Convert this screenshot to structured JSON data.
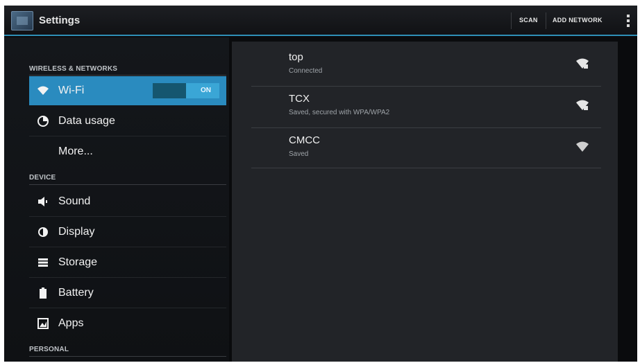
{
  "actionbar": {
    "title": "Settings",
    "scan_label": "SCAN",
    "add_network_label": "ADD NETWORK",
    "icon": "settings-app-icon",
    "accent": "#2f8fb6"
  },
  "sidebar": {
    "section_wireless": "WIRELESS & NETWORKS",
    "section_device": "DEVICE",
    "section_personal": "PERSONAL",
    "items": [
      {
        "label": "Wi-Fi",
        "icon": "wifi-icon",
        "toggle": "ON",
        "selected": true
      },
      {
        "label": "Data usage",
        "icon": "data-usage-icon"
      },
      {
        "label": "More...",
        "icon": ""
      },
      {
        "label": "Sound",
        "icon": "speaker-icon"
      },
      {
        "label": "Display",
        "icon": "display-icon"
      },
      {
        "label": "Storage",
        "icon": "storage-icon"
      },
      {
        "label": "Battery",
        "icon": "battery-icon"
      },
      {
        "label": "Apps",
        "icon": "apps-icon"
      }
    ],
    "selected_color": "#2a8bbf"
  },
  "networks": [
    {
      "ssid": "top",
      "status": "Connected",
      "signal_icon": "wifi-locked-signal-icon"
    },
    {
      "ssid": "TCX",
      "status": "Saved, secured with WPA/WPA2",
      "signal_icon": "wifi-locked-signal-icon"
    },
    {
      "ssid": "CMCC",
      "status": "Saved",
      "signal_icon": "wifi-signal-icon"
    }
  ]
}
